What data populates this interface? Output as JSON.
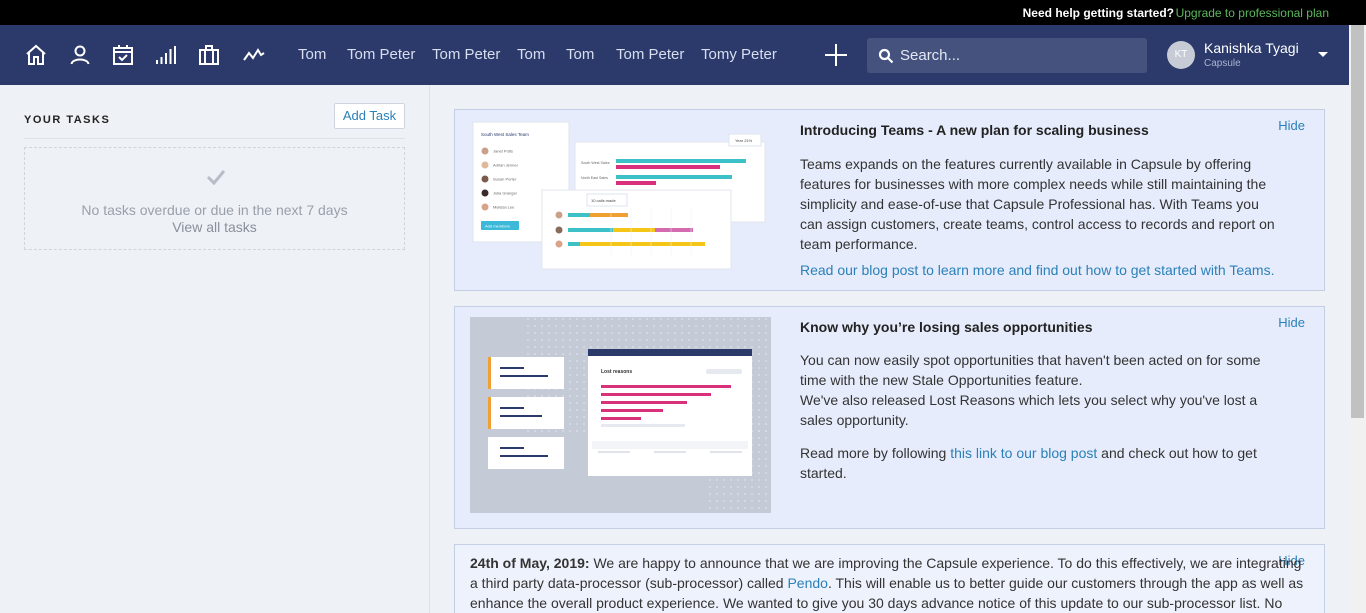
{
  "topbar": {
    "help": "Need help getting started?",
    "upgrade": "Upgrade to professional plan"
  },
  "nav": {
    "icons": [
      "home-icon",
      "person-icon",
      "calendar-icon",
      "bar-chart-icon",
      "briefcase-icon",
      "activity-icon"
    ],
    "links": [
      "Tom",
      "Tom Peter",
      "Tom Peter",
      "Tom",
      "Tom",
      "Tom Peter",
      "Tomy Peter"
    ],
    "search_placeholder": "Search...",
    "user": {
      "initials": "KT",
      "name": "Kanishka Tyagi",
      "company": "Capsule"
    }
  },
  "sidebar": {
    "title": "YOUR TASKS",
    "add_task": "Add Task",
    "empty_msg": "No tasks overdue or due in the next 7 days",
    "view_all": "View all tasks"
  },
  "cards": [
    {
      "hide": "Hide",
      "title": "Introducing Teams - A new plan for scaling business",
      "body": "Teams expands on the features currently available in Capsule by offering features for businesses with more complex needs while still maintaining the simplicity and ease-of-use that Capsule Professional has. With Teams you can assign customers, create teams, control access to records and report on team performance.",
      "link": "Read our blog post to learn more and find out how to get started with Teams.",
      "illustration": {
        "team_title": "South West Sales Team",
        "members": [
          "Janet Potts",
          "Adrian Jenner",
          "Susan Porter",
          "Julia Granger",
          "Melissa Lee"
        ],
        "add_button": "Add members",
        "chart_rows": [
          "South West Sales",
          "North East Sales"
        ],
        "chart_badge": "Year 21%",
        "calls_label": "10 calls made"
      }
    },
    {
      "hide": "Hide",
      "title": "Know why you’re losing sales opportunities",
      "body1": "You can now easily spot opportunities that haven't been acted on for some time with the new Stale Opportunities feature.",
      "body2": "We've also released Lost Reasons which lets you select why you've lost a sales opportunity.",
      "body3_prefix": "Read more by following ",
      "body3_link": "this link to our blog post",
      "body3_suffix": " and check out how to get started.",
      "illustration": {
        "panel_title": "Lost reasons"
      }
    },
    {
      "hide": "Hide",
      "date": "24th of May, 2019:",
      "text1": " We are happy to announce that we are improving the Capsule experience. To do this effectively, we are integrating a third party data-processor (sub-processor) called ",
      "link": "Pendo",
      "text2": ". This will enable us to better guide our customers through the app as well as enhance the overall product experience. We wanted to give you 30 days advance notice of this update to our sub-processor list. No action is"
    }
  ],
  "colors": {
    "nav_bg": "#2b3a6b",
    "link": "#2a80b9",
    "upgrade": "#5cb85c",
    "card_bg": "#e6ecfb",
    "teal": "#3cc1c8",
    "magenta": "#d8307a",
    "yellow": "#f5c518",
    "orange": "#f0a030"
  }
}
